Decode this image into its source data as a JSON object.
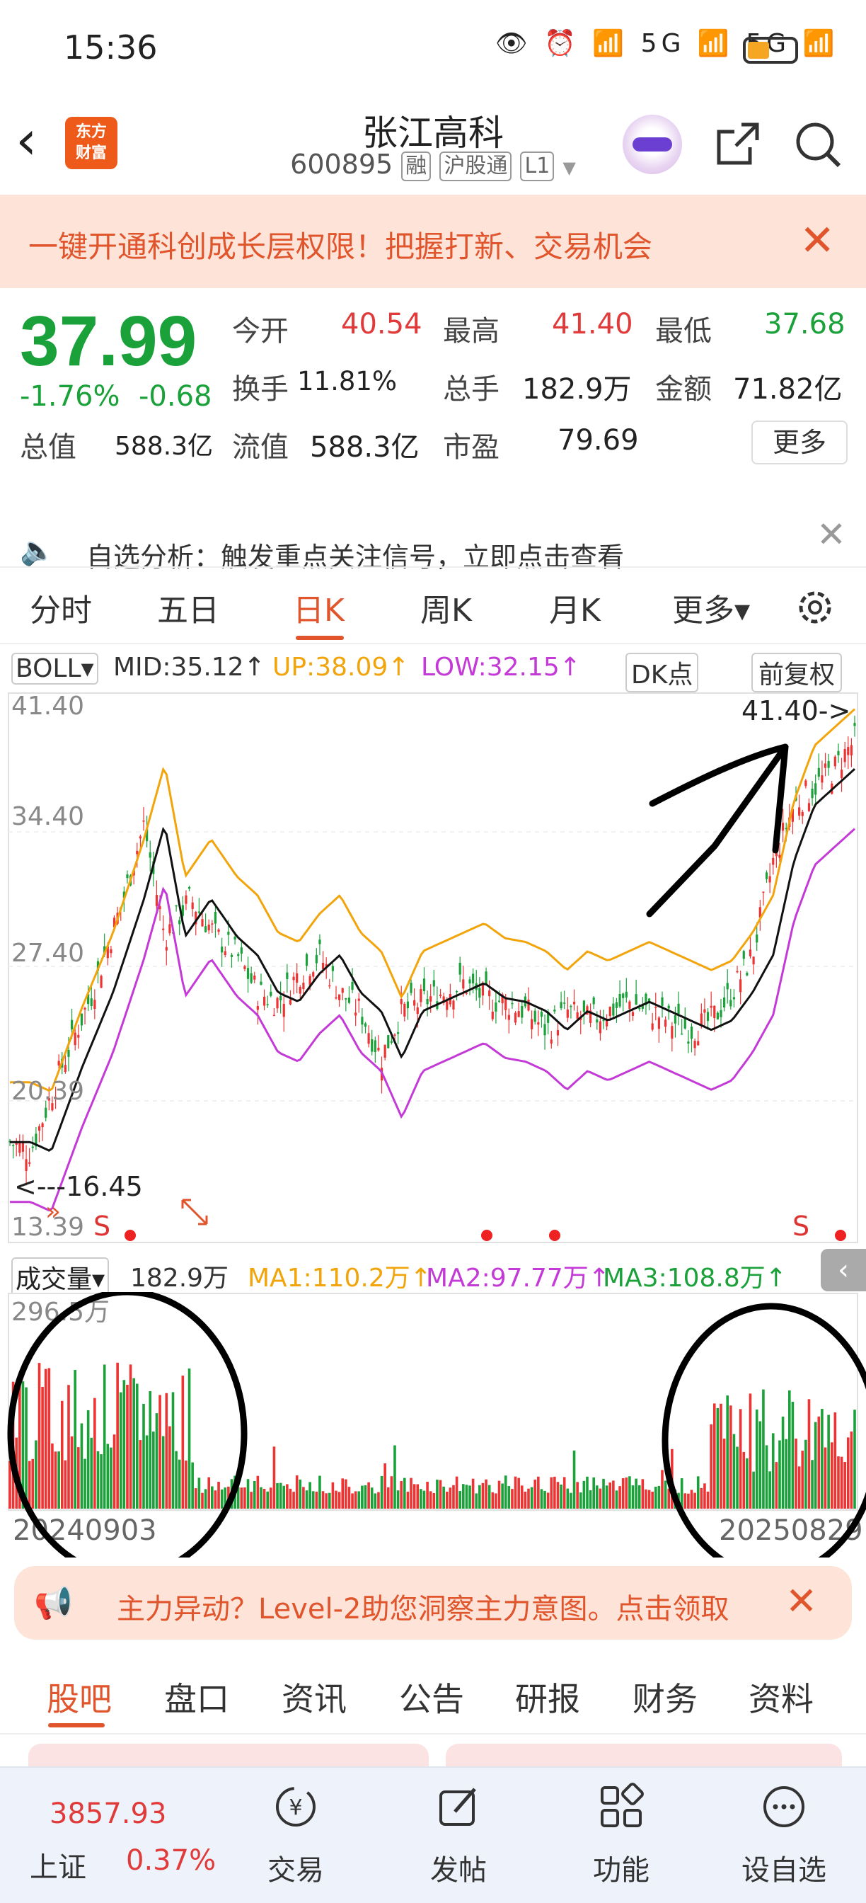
{
  "status": {
    "time": "15:36",
    "icons_text": "👁 ⏰ 📶 5G 📶 5G 📶"
  },
  "header": {
    "logo_text": "东方\n财富",
    "stock_name": "张江高科",
    "stock_code": "600895",
    "tags": [
      "融",
      "沪股通",
      "L1"
    ]
  },
  "promo": {
    "text": "一键开通科创成长层权限！把握打新、交易机会",
    "close": "✕"
  },
  "quote": {
    "price": "37.99",
    "change_pct": "-1.76%",
    "change_amt": "-0.68",
    "fields": [
      {
        "label": "今开",
        "value": "40.54",
        "color": "red"
      },
      {
        "label": "最高",
        "value": "41.40",
        "color": "red"
      },
      {
        "label": "最低",
        "value": "37.68",
        "color": "green"
      },
      {
        "label": "换手",
        "value": "11.81%",
        "color": "normal"
      },
      {
        "label": "总手",
        "value": "182.9万",
        "color": "normal"
      },
      {
        "label": "金额",
        "value": "71.82亿",
        "color": "normal"
      },
      {
        "label": "总值",
        "value": "588.3亿",
        "color": "normal"
      },
      {
        "label": "流值",
        "value": "588.3亿",
        "color": "normal"
      },
      {
        "label": "市盈",
        "value": "79.69",
        "color": "normal"
      }
    ],
    "more_label": "更多"
  },
  "notice": {
    "text": "自选分析：触发重点关注信号，立即点击查看",
    "close": "✕"
  },
  "period_tabs": [
    "分时",
    "五日",
    "日K",
    "周K",
    "月K",
    "更多▾"
  ],
  "active_period": "日K",
  "indicator": {
    "name": "BOLL▾",
    "mid": "MID:35.12↑",
    "up": "UP:38.09↑",
    "low": "LOW:32.15↑",
    "dk": "DK点",
    "adjust": "前复权"
  },
  "chart_data": {
    "type": "candlestick",
    "y_ticks": [
      "41.40",
      "34.40",
      "27.40",
      "20.39",
      "13.39"
    ],
    "ylim": [
      13.39,
      41.4
    ],
    "high_marker": "41.40->",
    "low_marker": "<---16.45",
    "signals": [
      "S",
      "S"
    ],
    "x_labels": [
      "20240903",
      "20250829"
    ],
    "volume": {
      "label": "成交量▾",
      "value": "182.9万",
      "ma1": "MA1:110.2万↑",
      "ma2": "MA2:97.77万↑",
      "ma3": "MA3:108.8万↑",
      "max_tick": "296.5万"
    }
  },
  "level2": {
    "text": "主力异动？Level-2助您洞察主力意图。点击领取",
    "close": "✕"
  },
  "bottom_tabs": [
    "股吧",
    "盘口",
    "资讯",
    "公告",
    "研报",
    "财务",
    "资料"
  ],
  "index": {
    "value": "3857.93",
    "name": "上证",
    "pct": "0.37%"
  },
  "nav": [
    {
      "label": "交易",
      "icon": "trade-icon"
    },
    {
      "label": "发帖",
      "icon": "post-icon"
    },
    {
      "label": "功能",
      "icon": "functions-icon"
    },
    {
      "label": "设自选",
      "icon": "favorite-icon"
    }
  ]
}
